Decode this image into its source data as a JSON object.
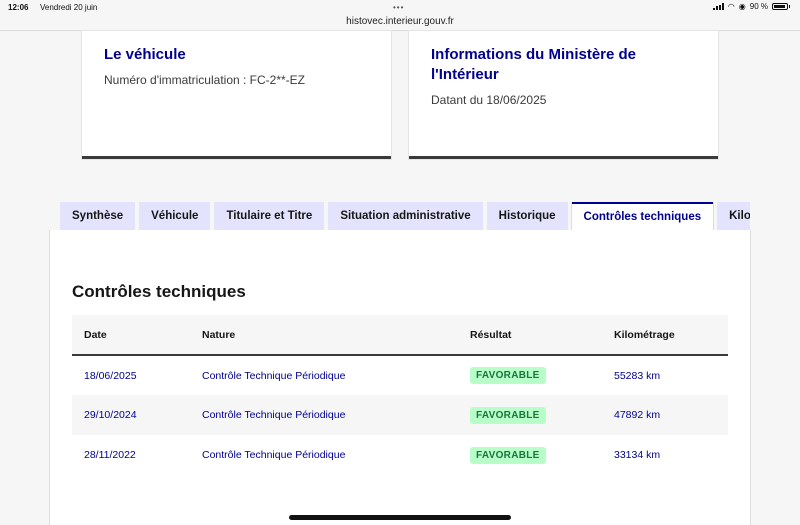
{
  "status": {
    "time": "12:06",
    "date": "Vendredi 20 juin",
    "battery": "90 %",
    "battery_level": 0.9
  },
  "browser": {
    "url": "histovec.interieur.gouv.fr"
  },
  "cards": [
    {
      "title": "Le véhicule",
      "text": "Numéro d'immatriculation : FC-2**-EZ"
    },
    {
      "title": "Informations du Ministère de l'Intérieur",
      "text": "Datant du 18/06/2025"
    }
  ],
  "tabs": [
    {
      "label": "Synthèse",
      "active": false
    },
    {
      "label": "Véhicule",
      "active": false
    },
    {
      "label": "Titulaire et Titre",
      "active": false
    },
    {
      "label": "Situation administrative",
      "active": false
    },
    {
      "label": "Historique",
      "active": false
    },
    {
      "label": "Contrôles techniques",
      "active": true
    },
    {
      "label": "Kilo",
      "active": false
    }
  ],
  "section": {
    "title": "Contrôles techniques",
    "columns": [
      "Date",
      "Nature",
      "Résultat",
      "Kilométrage"
    ],
    "rows": [
      {
        "date": "18/06/2025",
        "nature": "Contrôle Technique Périodique",
        "result": "FAVORABLE",
        "km": "55283 km"
      },
      {
        "date": "29/10/2024",
        "nature": "Contrôle Technique Périodique",
        "result": "FAVORABLE",
        "km": "47892 km"
      },
      {
        "date": "28/11/2022",
        "nature": "Contrôle Technique Périodique",
        "result": "FAVORABLE",
        "km": "33134 km"
      }
    ]
  }
}
